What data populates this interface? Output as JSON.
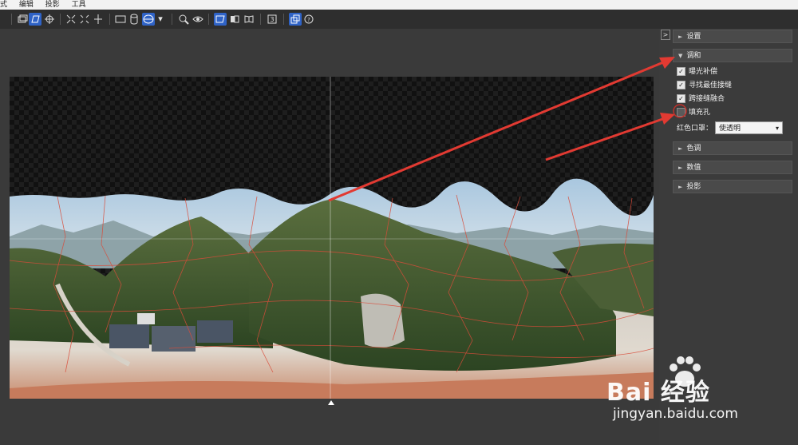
{
  "menu": [
    "式",
    "编辑",
    "投影",
    "工具"
  ],
  "toolbar": {
    "icons": [
      "panorama-icon",
      "edit-mask-icon",
      "move-icon",
      "fit-icon",
      "crop-icon",
      "straighten-icon",
      "rect-projection-icon",
      "cylinder-projection-icon",
      "sphere-projection-icon",
      "dropdown-icon",
      "zoom-icon",
      "preview-icon",
      "view1-icon",
      "view2-icon",
      "view3-icon",
      "number-icon",
      "layers-icon",
      "help-icon"
    ],
    "active": [
      "edit-mask-icon",
      "sphere-projection-icon",
      "view1-icon",
      "layers-icon"
    ]
  },
  "panel": {
    "collapse": ">",
    "sections": [
      {
        "label": "设置",
        "expanded": false
      },
      {
        "label": "调和",
        "expanded": true
      },
      {
        "label": "色调",
        "expanded": false
      },
      {
        "label": "数值",
        "expanded": false
      },
      {
        "label": "投影",
        "expanded": false
      }
    ],
    "options": [
      {
        "label": "曝光补偿",
        "checked": true
      },
      {
        "label": "寻找最佳接缝",
        "checked": true
      },
      {
        "label": "跨接缝融合",
        "checked": true
      },
      {
        "label": "填充孔",
        "checked": false
      }
    ],
    "red_mask_label": "红色口罩：",
    "red_mask_value": "使透明"
  },
  "watermark": {
    "brand": "Bai 经验",
    "url": "jingyan.baidu.com"
  },
  "colors": {
    "accent": "#2f63c7",
    "annotation": "#e23a32",
    "background": "#3a3a3a"
  }
}
